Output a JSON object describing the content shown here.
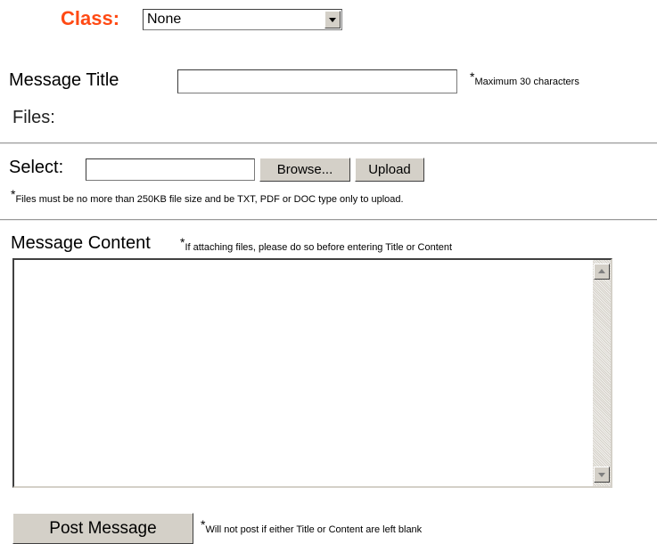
{
  "class_field": {
    "label": "Class:",
    "selected": "None",
    "accent_color": "#ff4a14"
  },
  "message_title": {
    "label": "Message Title",
    "value": "",
    "note_star": "*",
    "note": "Maximum 30 characters"
  },
  "files": {
    "label": "Files:"
  },
  "upload": {
    "label": "Select:",
    "file_value": "",
    "browse_label": "Browse...",
    "upload_label": "Upload",
    "note_star": "*",
    "note": "Files must be no more than 250KB file size and be TXT, PDF or DOC type only to upload."
  },
  "message_content": {
    "label": "Message Content",
    "note_star": "*",
    "note": "If attaching files, please do so before entering Title or Content",
    "value": ""
  },
  "post": {
    "button_label": "Post Message",
    "note_star": "*",
    "note": "Will not post if either Title or Content are left blank"
  },
  "icons": {
    "dropdown": "chevron-down-icon",
    "scroll_up": "arrow-up-icon",
    "scroll_down": "arrow-down-icon"
  }
}
